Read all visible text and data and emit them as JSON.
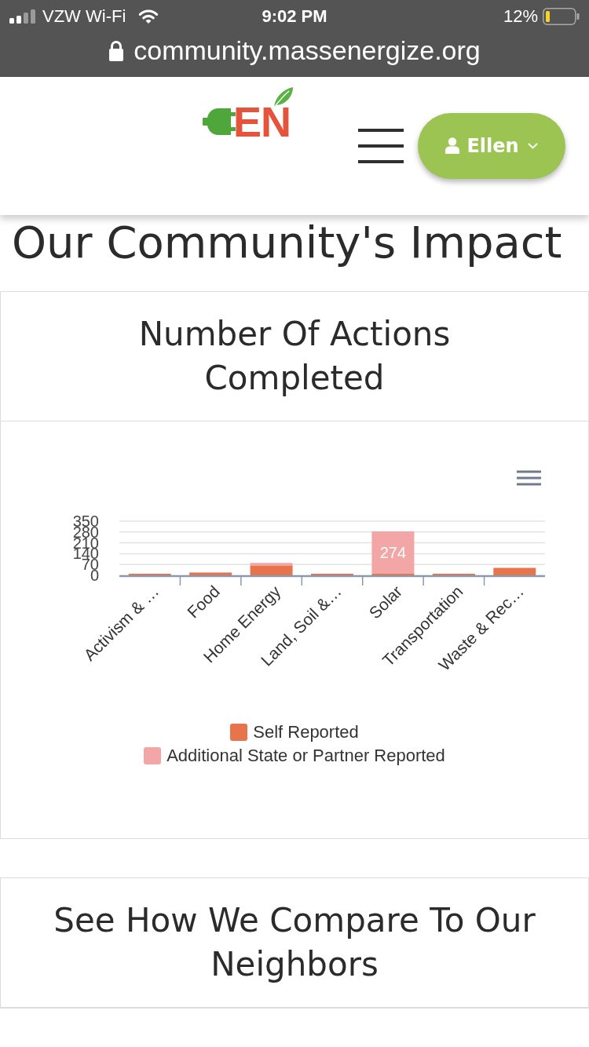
{
  "status_bar": {
    "carrier": "VZW Wi-Fi",
    "time": "9:02 PM",
    "battery": "12%",
    "url": "community.massenergize.org"
  },
  "header": {
    "logo_text": "EN",
    "user_button": "Ellen"
  },
  "page_title": "Our Community's Impact",
  "cards": [
    {
      "title": "Number Of Actions Completed",
      "chart_data": {
        "type": "bar",
        "orientation": "vertical",
        "stacked": true,
        "grid": true,
        "legend": true,
        "categories": [
          "Activism & …",
          "Food",
          "Home Energy",
          "Land, Soil &…",
          "Solar",
          "Transportation",
          "Waste & Rec…"
        ],
        "series": [
          {
            "name": "Self Reported",
            "color": "#e8744c",
            "values": [
              10,
              18,
              64,
              10,
              10,
              10,
              48
            ]
          },
          {
            "name": "Additional State or Partner Reported",
            "color": "#f2a7a6",
            "values": [
              0,
              0,
              16,
              0,
              274,
              0,
              0
            ],
            "value_labels": [
              null,
              null,
              null,
              null,
              "274",
              null,
              null
            ]
          }
        ],
        "ylim": [
          0,
          350
        ],
        "yticks": [
          0,
          70,
          140,
          210,
          280,
          350
        ]
      }
    },
    {
      "title": "See How We Compare To Our Neighbors"
    }
  ]
}
